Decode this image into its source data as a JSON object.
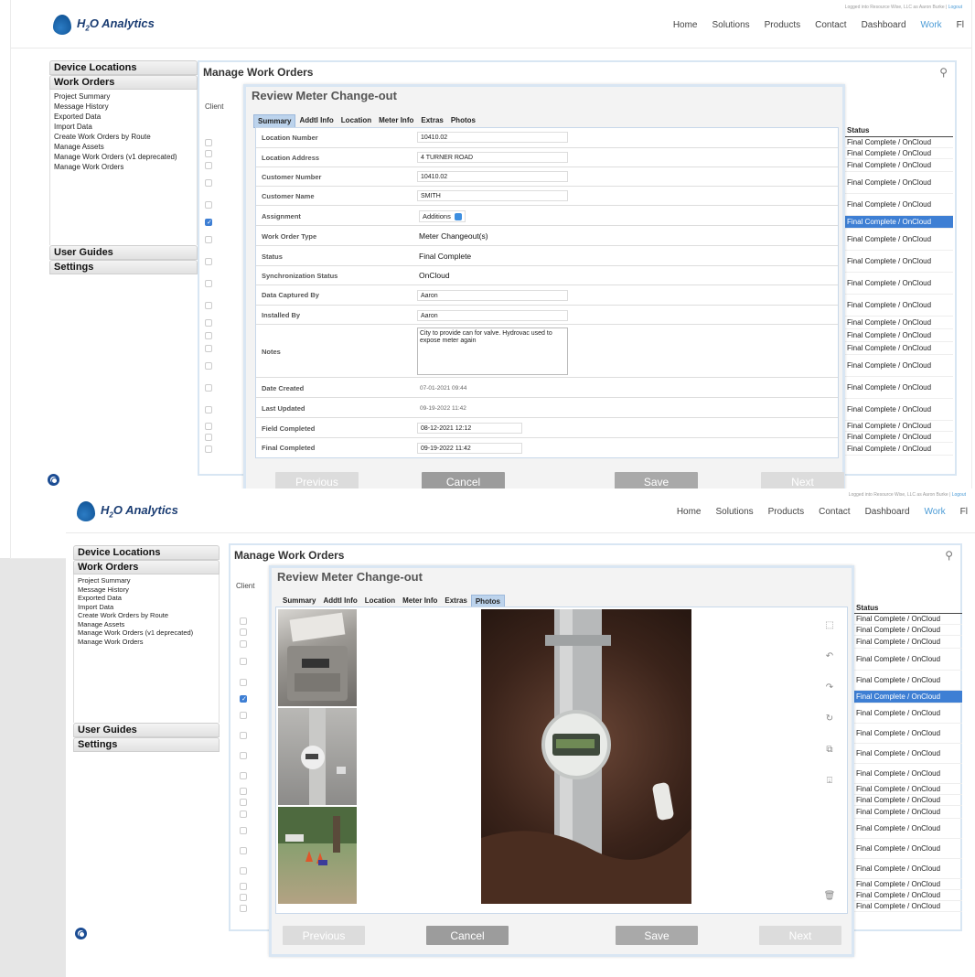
{
  "header": {
    "login_text": "Logged into Resource Wise, LLC as Aaron Burke |",
    "logout": "Logout",
    "brand": "H",
    "brand_sub": "2",
    "brand_rest": "O Analytics",
    "nav": [
      "Home",
      "Solutions",
      "Products",
      "Contact",
      "Dashboard",
      "Work",
      "Fl"
    ],
    "active_nav": "Work"
  },
  "sidebar": {
    "device_locations": "Device Locations",
    "work_orders": "Work Orders",
    "items": [
      "Project Summary",
      "Message History",
      "Exported Data",
      "Import Data",
      "Create Work Orders by Route",
      "Manage Assets",
      "Manage Work Orders (v1 deprecated)",
      "Manage Work Orders"
    ],
    "user_guides": "User Guides",
    "settings": "Settings"
  },
  "manage": {
    "title": "Manage Work Orders",
    "client_label": "Client",
    "status_header": "Status",
    "status_value": "Final Complete / OnCloud",
    "selected_index": 5
  },
  "modal": {
    "title": "Review Meter Change-out",
    "tabs": [
      "Summary",
      "Addtl Info",
      "Location",
      "Meter Info",
      "Extras",
      "Photos"
    ],
    "fields": {
      "location_number": {
        "label": "Location Number",
        "value": "10410.02"
      },
      "location_address": {
        "label": "Location Address",
        "value": "4 TURNER ROAD"
      },
      "customer_number": {
        "label": "Customer Number",
        "value": "10410.02"
      },
      "customer_name": {
        "label": "Customer Name",
        "value": "SMITH"
      },
      "assignment": {
        "label": "Assignment",
        "value": "Additions"
      },
      "work_order_type": {
        "label": "Work Order Type",
        "value": "Meter Changeout(s)"
      },
      "status": {
        "label": "Status",
        "value": "Final Complete"
      },
      "sync_status": {
        "label": "Synchronization Status",
        "value": "OnCloud"
      },
      "captured_by": {
        "label": "Data Captured By",
        "value": "Aaron"
      },
      "installed_by": {
        "label": "Installed By",
        "value": "Aaron"
      },
      "notes": {
        "label": "Notes",
        "value": "City to provide can for valve. Hydrovac used to expose meter again"
      },
      "date_created": {
        "label": "Date Created",
        "value": "07-01-2021 09:44"
      },
      "last_updated": {
        "label": "Last Updated",
        "value": "09-19-2022 11:42"
      },
      "field_completed": {
        "label": "Field Completed",
        "value": "08-12-2021 12:12"
      },
      "final_completed": {
        "label": "Final Completed",
        "value": "09-19-2022 11:42"
      }
    },
    "buttons": {
      "previous": "Previous",
      "cancel": "Cancel",
      "save": "Save",
      "next": "Next"
    }
  },
  "photo_icons": [
    "crop-icon",
    "undo-icon",
    "redo-icon",
    "reset-icon",
    "open-external-icon",
    "download-icon",
    "trash-icon"
  ]
}
